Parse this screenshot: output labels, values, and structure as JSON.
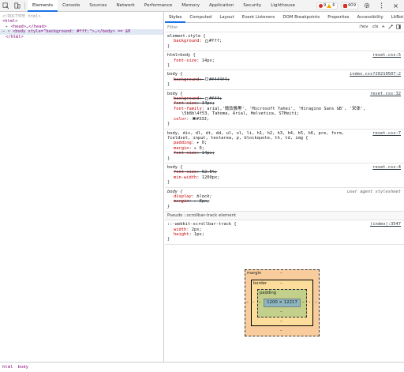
{
  "toolbar": {
    "tabs": [
      "Elements",
      "Console",
      "Sources",
      "Network",
      "Performance",
      "Memory",
      "Application",
      "Security",
      "Lighthouse"
    ],
    "active_tab": "Elements",
    "errors_count": "9",
    "warnings_count": "6",
    "issues_count": "409"
  },
  "dom": {
    "doctype": "<!DOCTYPE html>",
    "html_open": "<html>",
    "head": "<head>…</head>",
    "body_line": "<body style=\"background: #fff;\">…</body> == $0",
    "html_close": "</html>"
  },
  "breadcrumb": {
    "item1": "html",
    "item2": "body"
  },
  "styles_tabs": [
    "Styles",
    "Computed",
    "Layout",
    "Event Listeners",
    "DOM Breakpoints",
    "Properties",
    "Accessibility",
    "LitBot"
  ],
  "active_styles_tab": "Styles",
  "filter": {
    "placeholder": "Filter",
    "hov": ":hov",
    "cls": ".cls",
    "plus": "+"
  },
  "rules": [
    {
      "selector": "element.style {",
      "source": "",
      "decls": [
        {
          "name": "background",
          "value": "#fff;",
          "swatch": "#ffffff",
          "strike": false
        }
      ]
    },
    {
      "selector": "html>body {",
      "source": "reset.css:5",
      "decls": [
        {
          "name": "font-size",
          "value": "14px;",
          "strike": false
        }
      ]
    },
    {
      "selector": "body {",
      "source": "index.css?20210507:2",
      "decls": [
        {
          "name": "background",
          "value": "#f4f4f4;",
          "swatch": "#f4f4f4",
          "strike": true
        }
      ]
    },
    {
      "selector": "body {",
      "source": "reset.css:32",
      "decls": [
        {
          "name": "background",
          "value": "#fff;",
          "swatch": "#ffffff",
          "strike": true
        },
        {
          "name": "font-size",
          "value": "14px;",
          "strike": true
        },
        {
          "name": "font-family",
          "value": "arial,'微软雅黑', 'Microsoft Yahei', 'Hiragino Sans GB', '宋体',",
          "strike": false
        },
        {
          "name": "",
          "value": "\\5b8b\\4f53, Tahoma, Arial, Helvetica, STHeiti;",
          "strike": false
        },
        {
          "name": "color",
          "value": "#333;",
          "swatch": "#333333",
          "strike": false
        }
      ]
    },
    {
      "selector": "body, div, dl, dt, dd, ul, ol, li, h1, h2, h3, h4, h5, h6, pre, form,",
      "selector2": "fieldset, input, textarea, p, blockquote, th, td, img {",
      "source": "reset.css:7",
      "decls": [
        {
          "name": "padding",
          "value": "▸ 0;",
          "strike": false
        },
        {
          "name": "margin",
          "value": "▸ 0;",
          "strike": false
        },
        {
          "name": "font-size",
          "value": "14px;",
          "strike": true
        }
      ]
    },
    {
      "selector": "body {",
      "source": "reset.css:4",
      "decls": [
        {
          "name": "font-size",
          "value": "62.5%;",
          "strike": true
        },
        {
          "name": "min-width",
          "value": "1200px;",
          "strike": false
        }
      ]
    },
    {
      "selector": "body {",
      "source": "user agent stylesheet",
      "ua": true,
      "decls": [
        {
          "name": "display",
          "value": "block;",
          "strike": false,
          "italic": true
        },
        {
          "name": "margin",
          "value": "▸ 8px;",
          "strike": true,
          "italic": true
        }
      ]
    }
  ],
  "pseudo_section": "Pseudo ::scrollbar-track element",
  "pseudo_rule": {
    "selector": "::-webkit-scrollbar-track {",
    "source": "(index):3547",
    "decls": [
      {
        "name": "width",
        "value": "2px;"
      },
      {
        "name": "height",
        "value": "1px;"
      }
    ]
  },
  "box_model": {
    "margin_label": "margin",
    "border_label": "border",
    "padding_label": "padding",
    "content": "1200 × 12217",
    "dash": "–"
  }
}
